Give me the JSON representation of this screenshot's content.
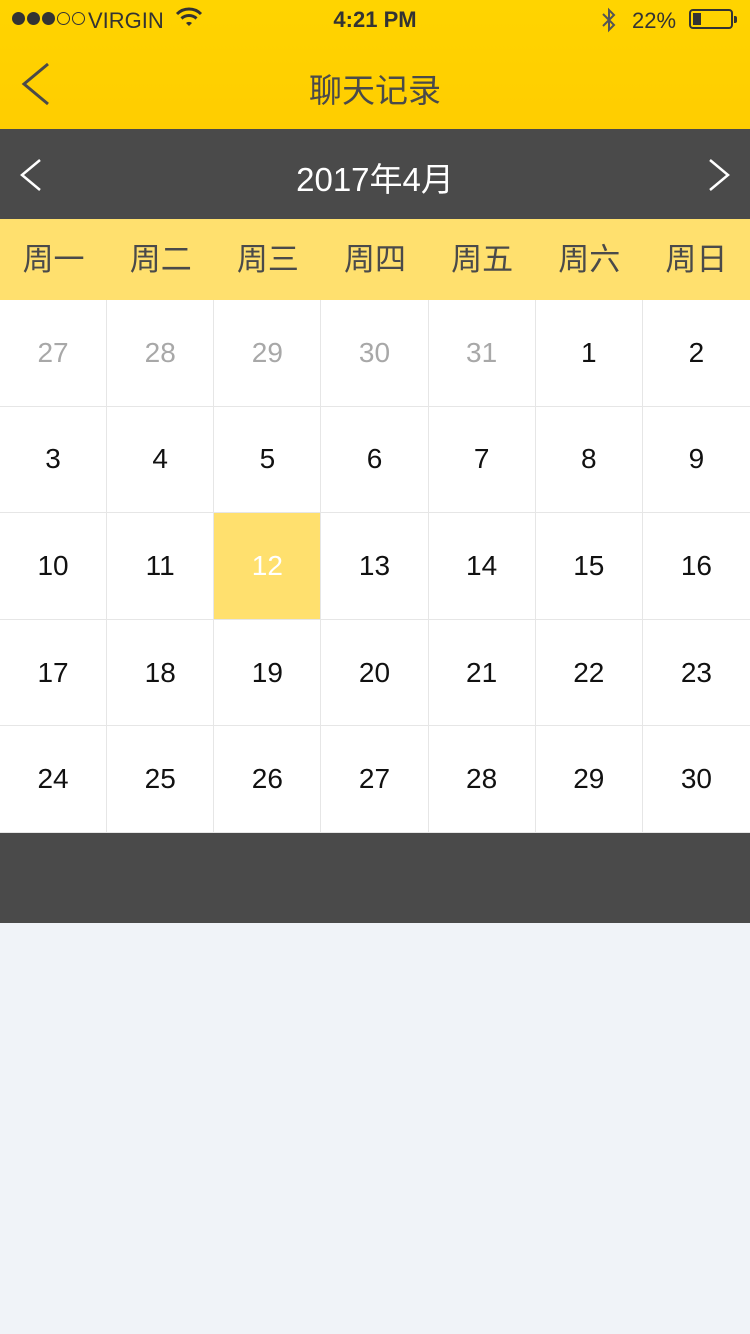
{
  "status_bar": {
    "carrier": "VIRGIN",
    "time": "4:21 PM",
    "battery_percent": "22%",
    "signal_bars_filled": 3,
    "signal_bars_total": 5
  },
  "nav": {
    "title": "聊天记录",
    "back_icon": "chevron-left-icon"
  },
  "calendar": {
    "month_label": "2017年4月",
    "prev_icon": "chevron-left-icon",
    "next_icon": "chevron-right-icon",
    "weekdays": [
      "周一",
      "周二",
      "周三",
      "周四",
      "周五",
      "周六",
      "周日"
    ],
    "days": [
      {
        "label": "27",
        "muted": true
      },
      {
        "label": "28",
        "muted": true
      },
      {
        "label": "29",
        "muted": true
      },
      {
        "label": "30",
        "muted": true
      },
      {
        "label": "31",
        "muted": true
      },
      {
        "label": "1"
      },
      {
        "label": "2"
      },
      {
        "label": "3"
      },
      {
        "label": "4"
      },
      {
        "label": "5"
      },
      {
        "label": "6"
      },
      {
        "label": "7"
      },
      {
        "label": "8"
      },
      {
        "label": "9"
      },
      {
        "label": "10"
      },
      {
        "label": "11"
      },
      {
        "label": "12",
        "selected": true
      },
      {
        "label": "13"
      },
      {
        "label": "14"
      },
      {
        "label": "15"
      },
      {
        "label": "16"
      },
      {
        "label": "17"
      },
      {
        "label": "18"
      },
      {
        "label": "19"
      },
      {
        "label": "20"
      },
      {
        "label": "21"
      },
      {
        "label": "22"
      },
      {
        "label": "23"
      },
      {
        "label": "24"
      },
      {
        "label": "25"
      },
      {
        "label": "26"
      },
      {
        "label": "27"
      },
      {
        "label": "28"
      },
      {
        "label": "29"
      },
      {
        "label": "30"
      }
    ]
  },
  "colors": {
    "brand_yellow": "#ffd400",
    "weekday_bg": "#ffe06e",
    "dark_bar": "#4a4a4a",
    "selected_bg": "#ffe06e"
  }
}
